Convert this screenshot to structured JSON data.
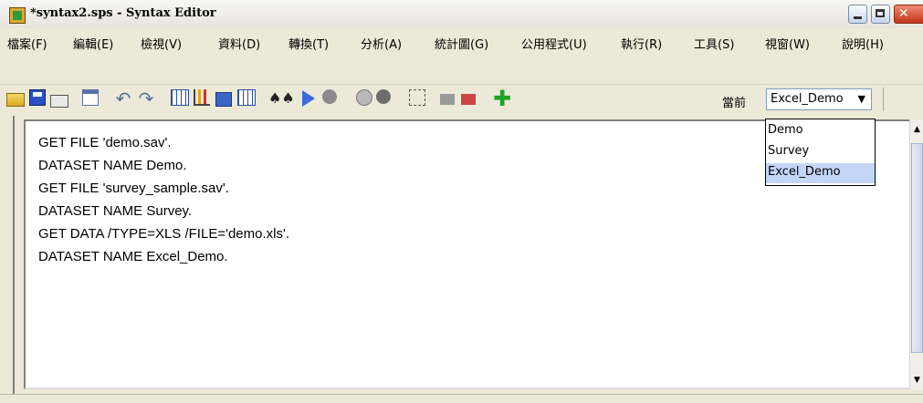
{
  "window": {
    "title": "*syntax2.sps - Syntax Editor"
  },
  "menu": {
    "items": [
      "檔案(F)",
      "編輯(E)",
      "檢視(V)",
      "資料(D)",
      "轉換(T)",
      "分析(A)",
      "統計圖(G)",
      "公用程式(U)",
      "執行(R)",
      "工具(S)",
      "視窗(W)",
      "說明(H)"
    ]
  },
  "toolbar": {
    "dataset_label": "當前",
    "dataset_value": "Excel_Demo",
    "icons": [
      "open-icon",
      "save-icon",
      "print-icon",
      "data-editor-icon",
      "undo-icon",
      "redo-icon",
      "goto-data-icon",
      "chart-icon",
      "insert-case-icon",
      "variables-icon",
      "find-icon",
      "run-icon",
      "stop-icon",
      "bookmark-icon",
      "toggle-bookmark-icon",
      "variable-list-icon",
      "help-icon",
      "use-sets-icon",
      "add-icon"
    ]
  },
  "dataset_dropdown": {
    "options": [
      "Demo",
      "Survey",
      "Excel_Demo"
    ],
    "selected": "Excel_Demo"
  },
  "editor": {
    "lines": [
      "GET FILE 'demo.sav'.",
      "DATASET NAME Demo.",
      "GET FILE 'survey_sample.sav'.",
      "DATASET NAME Survey.",
      "GET DATA /TYPE=XLS /FILE='demo.xls'.",
      "DATASET NAME Excel_Demo."
    ]
  },
  "colors": {
    "selection": "#c4d6f6",
    "chrome": "#ece9d8"
  }
}
